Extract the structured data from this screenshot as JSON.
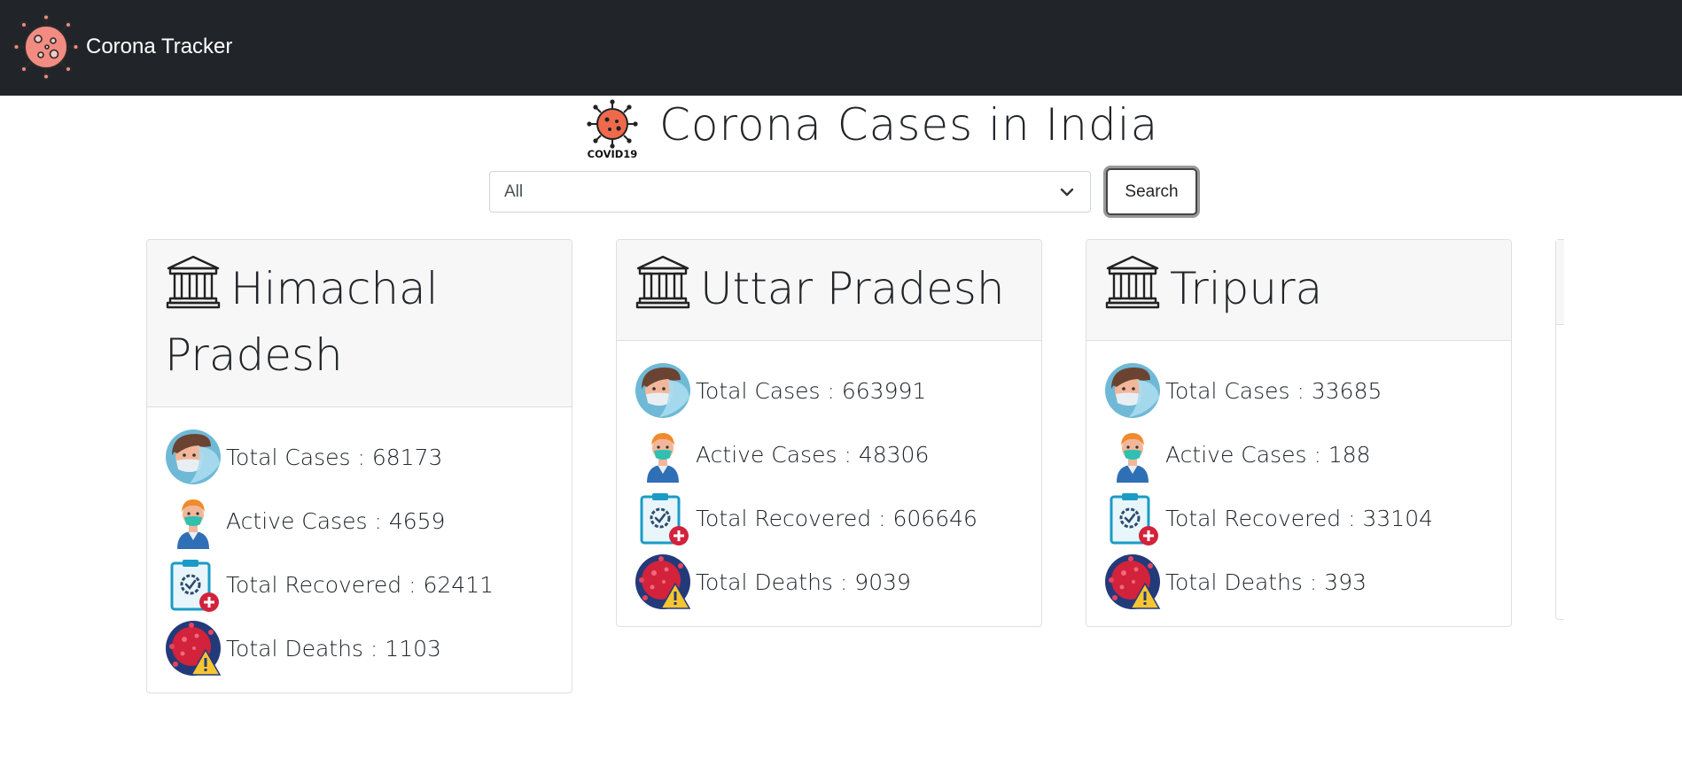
{
  "navbar": {
    "brand": "Corona Tracker",
    "logo_icon": "virus-icon"
  },
  "heading": {
    "title": "Corona Cases in India",
    "logo_text": "COVID19"
  },
  "search": {
    "selected": "All",
    "button_label": "Search"
  },
  "colors": {
    "navbar": "#212529",
    "virus": "#f28b82",
    "death": "#d3223b"
  },
  "stat_labels": {
    "total": "Total Cases",
    "active": "Active Cases",
    "recovered": "Total Recovered",
    "deaths": "Total Deaths"
  },
  "states": [
    {
      "name": "Himachal Pradesh",
      "total": "68173",
      "active": "4659",
      "recovered": "62411",
      "deaths": "1103"
    },
    {
      "name": "Uttar Pradesh",
      "total": "663991",
      "active": "48306",
      "recovered": "606646",
      "deaths": "9039"
    },
    {
      "name": "Tripura",
      "total": "33685",
      "active": "188",
      "recovered": "33104",
      "deaths": "393"
    }
  ]
}
